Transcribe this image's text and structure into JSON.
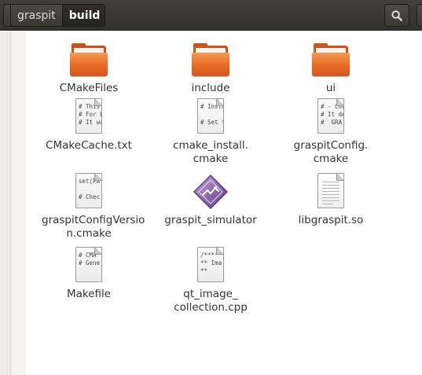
{
  "toolbar": {
    "breadcrumbs": [
      {
        "label": "graspit",
        "active": false
      },
      {
        "label": "build",
        "active": true
      }
    ],
    "search_icon": "search-icon"
  },
  "files": [
    {
      "name": "CMakeFiles",
      "type": "folder"
    },
    {
      "name": "include",
      "type": "folder"
    },
    {
      "name": "ui",
      "type": "folder"
    },
    {
      "name": "CMakeCache.txt",
      "type": "text",
      "preview": "# This\n# For b\n# It wa"
    },
    {
      "name": "cmake_install.\ncmake",
      "type": "text",
      "preview": "# Insta\n\n# Set th"
    },
    {
      "name": "graspitConfig.\ncmake",
      "type": "text",
      "preview": "# - Cor\n# It de\n#  GRA"
    },
    {
      "name": "graspitConfigVersio\nn.cmake",
      "type": "text",
      "preview": "set(PA\n\n# Chec"
    },
    {
      "name": "graspit_simulator",
      "type": "executable"
    },
    {
      "name": "libgraspit.so",
      "type": "library"
    },
    {
      "name": "Makefile",
      "type": "text",
      "preview": "# CMA\n# Gene"
    },
    {
      "name": "qt_image_\ncollection.cpp",
      "type": "text",
      "preview": "/*****\n** Ima\n**"
    }
  ],
  "colors": {
    "toolbar": "#3c3b37",
    "folder_orange": "#e66a23",
    "executable_purple": "#8e6bb0"
  }
}
